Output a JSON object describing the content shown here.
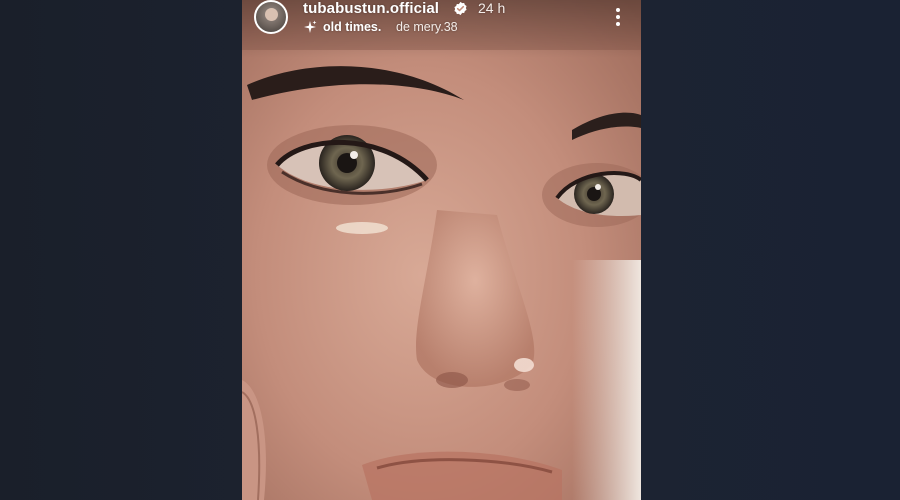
{
  "story": {
    "username": "tubabustun.official",
    "time": "24 h",
    "music": {
      "song": "old times.",
      "artist": "de mery.38"
    }
  },
  "icons": {
    "avatar": "profile-avatar",
    "verified": "verified-badge-icon",
    "music": "sparkle-music-icon",
    "more": "more-vertical-icon"
  },
  "colors": {
    "backdrop": "#1b2230",
    "text": "#ffffff",
    "verified_badge": "#ffffff"
  }
}
